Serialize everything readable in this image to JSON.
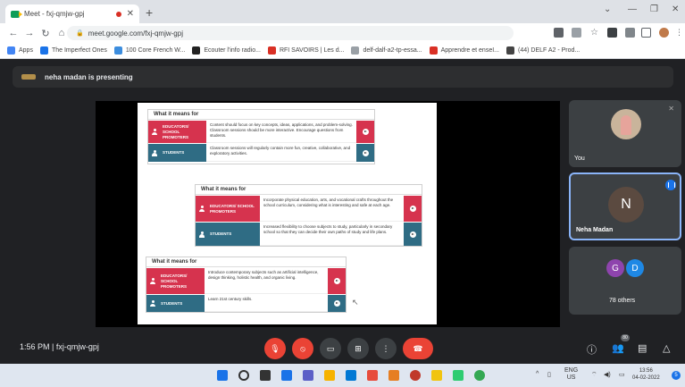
{
  "browser": {
    "tab_title": "Meet - fxj-qmjw-gpj",
    "url": "meet.google.com/fxj-qmjw-gpj",
    "bookmarks": [
      {
        "label": "Apps",
        "color": "#4285f4"
      },
      {
        "label": "The Imperfect Ones",
        "color": "#1a73e8"
      },
      {
        "label": "100 Core French W...",
        "color": "#3c8dde"
      },
      {
        "label": "Ecouter l'info radio...",
        "color": "#222222"
      },
      {
        "label": "RFI SAVOIRS | Les d...",
        "color": "#d93025"
      },
      {
        "label": "delf-dalf-a2-tp-essa...",
        "color": "#9aa0a6"
      },
      {
        "label": "Apprendre et enseI...",
        "color": "#d93025"
      },
      {
        "label": "(44) DELF A2 - Prod...",
        "color": "#444444"
      }
    ]
  },
  "meet": {
    "presenting_text": "neha madan is presenting",
    "meeting_time": "1:56 PM",
    "meeting_code": "fxj-qmjw-gpj",
    "participants": {
      "you_label": "You",
      "speaker_initial": "N",
      "speaker_name": "Neha Madan",
      "others_label": "78 others",
      "other_initials": [
        "G",
        "D"
      ],
      "people_count": "80"
    }
  },
  "slide": {
    "cards": [
      {
        "header": "What it means for",
        "rows": [
          {
            "label": "EDUCATORS/ SCHOOL PROMOTERS",
            "text": "Content should focus on key concepts, ideas, applications, and problem-solving. Classroom sessions should be more interactive. Encourage questions from students."
          },
          {
            "label": "STUDENTS",
            "text": "Classroom sessions will regularly contain more fun, creative, collaborative, and exploratory activities."
          }
        ]
      },
      {
        "header": "What it means for",
        "rows": [
          {
            "label": "EDUCATORS/ SCHOOL PROMOTERS",
            "text": "Incorporate physical education, arts, and vocational crafts throughout the school curriculum, considering what is interesting and safe at each age."
          },
          {
            "label": "STUDENTS",
            "text": "Increased flexibility to choose subjects to study, particularly in secondary school so that they can decide their own paths of study and life plans."
          }
        ]
      },
      {
        "header": "What it means for",
        "rows": [
          {
            "label": "EDUCATORS/ SCHOOL PROMOTERS",
            "text": "Introduce contemporary subjects such as artificial intelligence, design thinking, holistic health, and organic living."
          },
          {
            "label": "STUDENTS",
            "text": "Learn 21st century skills."
          }
        ]
      }
    ]
  },
  "taskbar": {
    "lang_top": "ENG",
    "lang_bottom": "US",
    "time": "13:56",
    "date": "04-02-2022",
    "notifications": "5"
  },
  "colors": {
    "educator_red": "#d6334e",
    "student_teal": "#2f6c84",
    "meet_bg": "#202124",
    "end_call": "#ea4335"
  }
}
